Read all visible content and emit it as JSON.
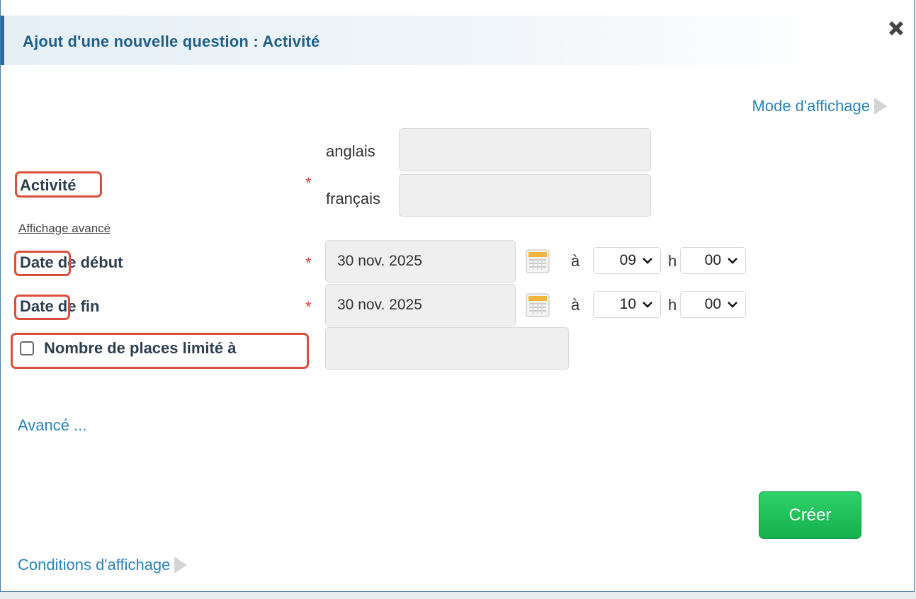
{
  "dialog": {
    "title": "Ajout d'une nouvelle question : Activité",
    "mode_link": "Mode d'affichage",
    "advanced_display_link": "Affichage avancé",
    "advanced_link": "Avancé ...",
    "conditions_link": "Conditions d'affichage",
    "create_button": "Créer"
  },
  "activity": {
    "label": "Activité",
    "required_mark": "*",
    "lang_en": "anglais",
    "lang_fr": "français",
    "value_en": "",
    "value_fr": ""
  },
  "start": {
    "label_highlight": "Date",
    "label_rest": " de début",
    "required_mark": "*",
    "date": "30 nov. 2025",
    "at": "à",
    "hour": "09",
    "h": "h",
    "minute": "00"
  },
  "end": {
    "label_highlight": "Date",
    "label_rest": " de fin",
    "required_mark": "*",
    "date": "30 nov. 2025",
    "at": "à",
    "hour": "10",
    "h": "h",
    "minute": "00"
  },
  "places": {
    "label": "Nombre de places limité à",
    "checked": false,
    "value": ""
  },
  "colors": {
    "accent": "#2a83b9",
    "header_bar": "#1f6fa0",
    "required": "#e23c3c",
    "highlight": "#d8503b",
    "create_button": "#1cbf55"
  }
}
